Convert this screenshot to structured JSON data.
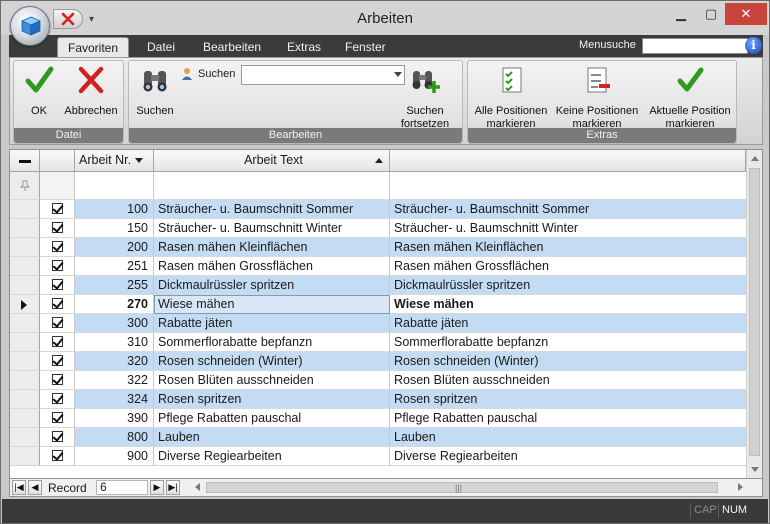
{
  "window": {
    "title": "Arbeiten"
  },
  "ribbon": {
    "tabs": [
      {
        "label": "Favoriten",
        "active": true
      },
      {
        "label": "Datei",
        "active": false
      },
      {
        "label": "Bearbeiten",
        "active": false
      },
      {
        "label": "Extras",
        "active": false
      },
      {
        "label": "Fenster",
        "active": false
      }
    ],
    "menusuche_label": "Menusuche",
    "help_icon_text": "i",
    "groups": {
      "datei": {
        "label": "Datei",
        "ok": "OK",
        "abbrechen": "Abbrechen"
      },
      "bearbeiten": {
        "label": "Bearbeiten",
        "suchen": "Suchen",
        "suchen_combo_label": "Suchen",
        "suchen_fortsetzen_1": "Suchen",
        "suchen_fortsetzen_2": "fortsetzen"
      },
      "extras": {
        "label": "Extras",
        "alle_1": "Alle Positionen",
        "alle_2": "markieren",
        "keine_1": "Keine Positionen",
        "keine_2": "markieren",
        "aktuelle_1": "Aktuelle Position",
        "aktuelle_2": "markieren"
      }
    }
  },
  "grid": {
    "columns": {
      "nr": "Arbeit Nr.",
      "text": "Arbeit Text"
    },
    "rows": [
      {
        "nr": "100",
        "text": "Sträucher- u. Baumschnitt Sommer",
        "text2": "Sträucher- u. Baumschnitt Sommer",
        "checked": true
      },
      {
        "nr": "150",
        "text": "Sträucher- u. Baumschnitt Winter",
        "text2": "Sträucher- u. Baumschnitt Winter",
        "checked": true
      },
      {
        "nr": "200",
        "text": "Rasen mähen Kleinflächen",
        "text2": "Rasen mähen Kleinflächen",
        "checked": true
      },
      {
        "nr": "251",
        "text": "Rasen mähen Grossflächen",
        "text2": "Rasen mähen Grossflächen",
        "checked": true
      },
      {
        "nr": "255",
        "text": "Dickmaulrüssler spritzen",
        "text2": "Dickmaulrüssler spritzen",
        "checked": true
      },
      {
        "nr": "270",
        "text": "Wiese mähen",
        "text2": "Wiese mähen",
        "checked": true,
        "current": true
      },
      {
        "nr": "300",
        "text": "Rabatte jäten",
        "text2": "Rabatte jäten",
        "checked": true
      },
      {
        "nr": "310",
        "text": "Sommerflorabatte bepfanzn",
        "text2": "Sommerflorabatte bepfanzn",
        "checked": true
      },
      {
        "nr": "320",
        "text": "Rosen schneiden (Winter)",
        "text2": "Rosen schneiden (Winter)",
        "checked": true
      },
      {
        "nr": "322",
        "text": "Rosen Blüten ausschneiden",
        "text2": "Rosen Blüten ausschneiden",
        "checked": true
      },
      {
        "nr": "324",
        "text": "Rosen spritzen",
        "text2": "Rosen spritzen",
        "checked": true
      },
      {
        "nr": "390",
        "text": "Pflege Rabatten pauschal",
        "text2": "Pflege Rabatten pauschal",
        "checked": true
      },
      {
        "nr": "800",
        "text": "Lauben",
        "text2": "Lauben",
        "checked": true
      },
      {
        "nr": "900",
        "text": "Diverse Regiearbeiten",
        "text2": "Diverse Regiearbeiten",
        "checked": true
      }
    ]
  },
  "navigator": {
    "record_label": "Record",
    "record_value": "6"
  },
  "statusbar": {
    "cap": "CAP",
    "num": "NUM"
  },
  "colors": {
    "row_alt": "#c3dcf4",
    "ok_green": "#2f9a1f",
    "cancel_red": "#d42020",
    "close_red": "#c9453b"
  }
}
